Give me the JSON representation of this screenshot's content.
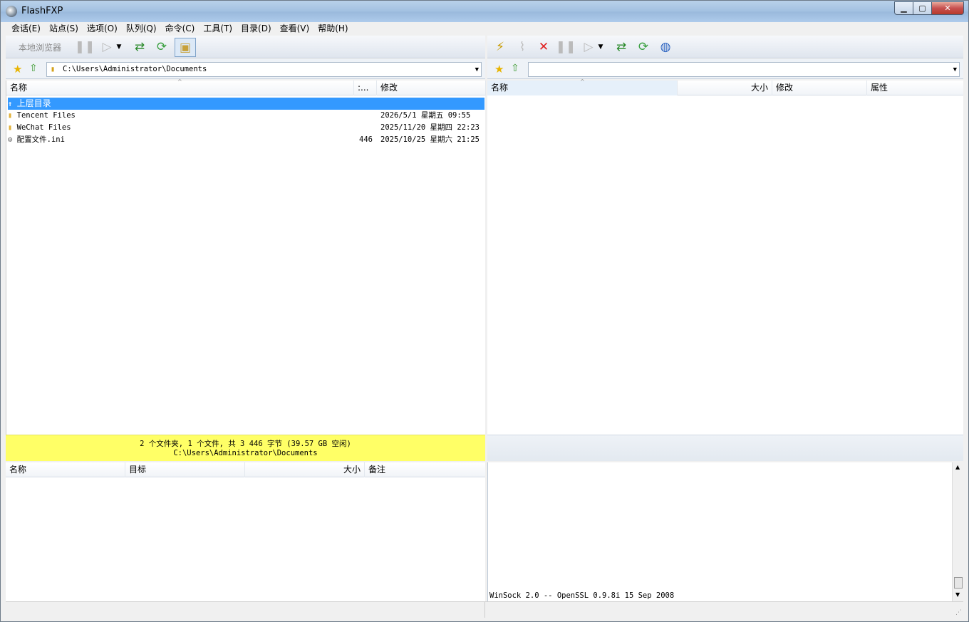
{
  "window": {
    "title": "FlashFXP"
  },
  "menu": [
    "会话(E)",
    "站点(S)",
    "选项(O)",
    "队列(Q)",
    "命令(C)",
    "工具(T)",
    "目录(D)",
    "查看(V)",
    "帮助(H)"
  ],
  "left": {
    "toolbar_label": "本地浏览器",
    "path": "C:\\Users\\Administrator\\Documents",
    "headers": {
      "name": "名称",
      "size": ":...",
      "modified": "修改"
    },
    "rows": [
      {
        "name": "上层目录",
        "size": "",
        "modified": ""
      },
      {
        "name": "Tencent Files",
        "size": "",
        "modified": "2026/5/1 星期五 09:55"
      },
      {
        "name": "WeChat Files",
        "size": "",
        "modified": "2025/11/20 星期四 22:23"
      },
      {
        "name": "配置文件.ini",
        "size": "446",
        "modified": "2025/10/25 星期六 21:25"
      }
    ],
    "status_line1": "2 个文件夹, 1 个文件, 共 3 446 字节 (39.57 GB 空闲)",
    "status_line2": "C:\\Users\\Administrator\\Documents"
  },
  "right": {
    "path": "",
    "headers": {
      "name": "名称",
      "size": "大小",
      "modified": "修改",
      "attr": "属性"
    }
  },
  "queue": {
    "headers": {
      "name": "名称",
      "target": "目标",
      "size": "大小",
      "note": "备注"
    }
  },
  "log": {
    "line": "WinSock 2.0 -- OpenSSL 0.9.8i 15 Sep 2008"
  }
}
